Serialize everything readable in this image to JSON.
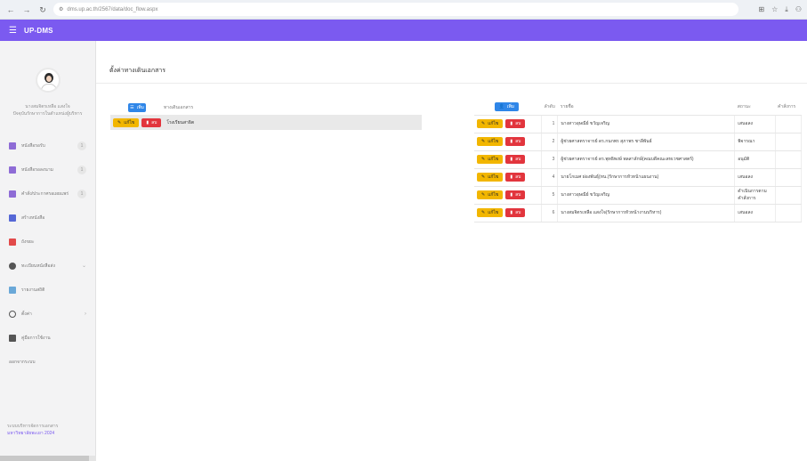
{
  "browser": {
    "url": "dms.up.ac.th/2567/data/doc_flow.aspx"
  },
  "app": {
    "brand": "UP-DMS"
  },
  "sidebar": {
    "profile_name": "นางสมจิตรเหลือ แสงใจ",
    "profile_role": "ปัจจุบันรักษาการในตำแหน่งผู้บริหาร",
    "items": [
      {
        "label": "หนังสือรอรับ",
        "badge": "1",
        "icon_color": "#8e6cd6"
      },
      {
        "label": "หนังสือรอลงนาม",
        "badge": "1",
        "icon_color": "#8e6cd6"
      },
      {
        "label": "คำสั่ง/ประกาศรอเผยแพร่",
        "badge": "1",
        "icon_color": "#8e6cd6"
      },
      {
        "label": "สร้างหนังสือ",
        "badge": "",
        "icon_color": "#5567d6"
      },
      {
        "label": "ถังขยะ",
        "badge": "",
        "icon_color": "#e24a4a"
      },
      {
        "label": "ทะเบียนหนังสือส่ง",
        "badge": "",
        "icon_color": "#555555"
      },
      {
        "label": "รายงานสถิติ",
        "badge": "",
        "icon_color": "#6aa8d8"
      },
      {
        "label": "ตั้งค่า",
        "badge": "",
        "icon_color": "#555555"
      },
      {
        "label": "คู่มือการใช้งาน",
        "badge": "",
        "icon_color": "#555555"
      },
      {
        "label": "ออกจากระบบ",
        "badge": "",
        "icon_color": ""
      }
    ],
    "footer_line1": "ระบบบริหารจัดการเอกสาร",
    "footer_line2": "มหาวิทยาลัยพะเยา 2024"
  },
  "main": {
    "page_title": "ตั้งค่าทางเดินเอกสาร",
    "left_table": {
      "add_label": "เพิ่ม",
      "column_title": "ทางเดินเอกสาร",
      "row": {
        "edit_label": "แก้ไข",
        "delete_label": "ลบ",
        "text": "โรงเรียนสาธิต"
      }
    },
    "right_table": {
      "add_label": "เพิ่ม",
      "headers": {
        "order": "ลำดับ",
        "name": "รายชื่อ",
        "status": "สถานะ",
        "command": "คำสั่งการ"
      },
      "edit_label": "แก้ไข",
      "delete_label": "ลบ",
      "rows": [
        {
          "order": "1",
          "name": "นางสาวอุษณีย์ ขวัญเจริญ",
          "status": "เสนอลง"
        },
        {
          "order": "2",
          "name": "ผู้ช่วยศาสตราจารย์ ดร.กนกพร สุภาพร ชาลีพันธ์",
          "status": "พิจารณา"
        },
        {
          "order": "3",
          "name": "ผู้ช่วยศาสตราจารย์ ดร.พุทธิพงษ์ พลสาลักษ์(คณบดีคณะสหเวชศาสตร์)",
          "status": "อนุมัติ"
        },
        {
          "order": "4",
          "name": "นายโกเมศ ผ่องพันธุ์(หน.(รักษาการหัวหน้าแผนงาน)",
          "status": "เสนอลง"
        },
        {
          "order": "5",
          "name": "นางสาวอุษณีย์ ขวัญเจริญ",
          "status": "ดำเนินการตามคำสั่งการ"
        },
        {
          "order": "6",
          "name": "นางสมจิตรเหลือ แสงใจ(รักษาการหัวหน้างานบริหาร)",
          "status": "เสนอลง"
        }
      ]
    }
  }
}
